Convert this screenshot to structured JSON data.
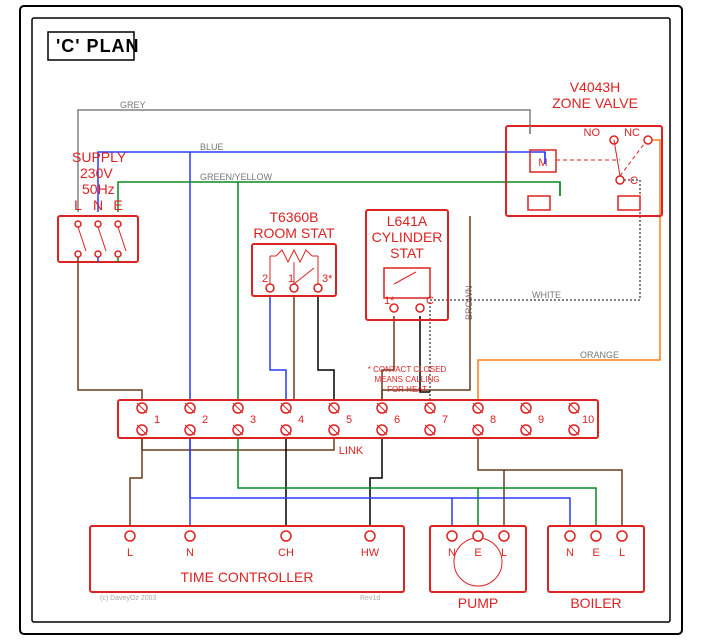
{
  "title": "'C' PLAN",
  "supply": {
    "label1": "SUPPLY",
    "label2": "230V",
    "label3": "50Hz",
    "L": "L",
    "N": "N",
    "E": "E"
  },
  "valve": {
    "label1": "V4043H",
    "label2": "ZONE VALVE",
    "M": "M",
    "NO": "NO",
    "NC": "NC",
    "C": "C"
  },
  "roomstat": {
    "label1": "T6360B",
    "label2": "ROOM STAT",
    "t1": "1",
    "t2": "2",
    "t3": "3*"
  },
  "cylstat": {
    "label1": "L641A",
    "label2": "CYLINDER",
    "label3": "STAT",
    "t1": "1*",
    "tC": "C",
    "note1": "* CONTACT CLOSED",
    "note2": "MEANS CALLING",
    "note3": "FOR HEAT"
  },
  "strip": {
    "link": "LINK",
    "n1": "1",
    "n2": "2",
    "n3": "3",
    "n4": "4",
    "n5": "5",
    "n6": "6",
    "n7": "7",
    "n8": "8",
    "n9": "9",
    "n10": "10"
  },
  "timectrl": {
    "label": "TIME CONTROLLER",
    "L": "L",
    "N": "N",
    "CH": "CH",
    "HW": "HW"
  },
  "pump": {
    "label": "PUMP",
    "N": "N",
    "E": "E",
    "L": "L"
  },
  "boiler": {
    "label": "BOILER",
    "N": "N",
    "E": "E",
    "L": "L"
  },
  "wires": {
    "grey": "GREY",
    "blue": "BLUE",
    "greenyellow": "GREEN/YELLOW",
    "brown": "BROWN",
    "white": "WHITE",
    "orange": "ORANGE"
  },
  "credit": "(c) DaveyOz 2003",
  "rev": "Rev1d"
}
